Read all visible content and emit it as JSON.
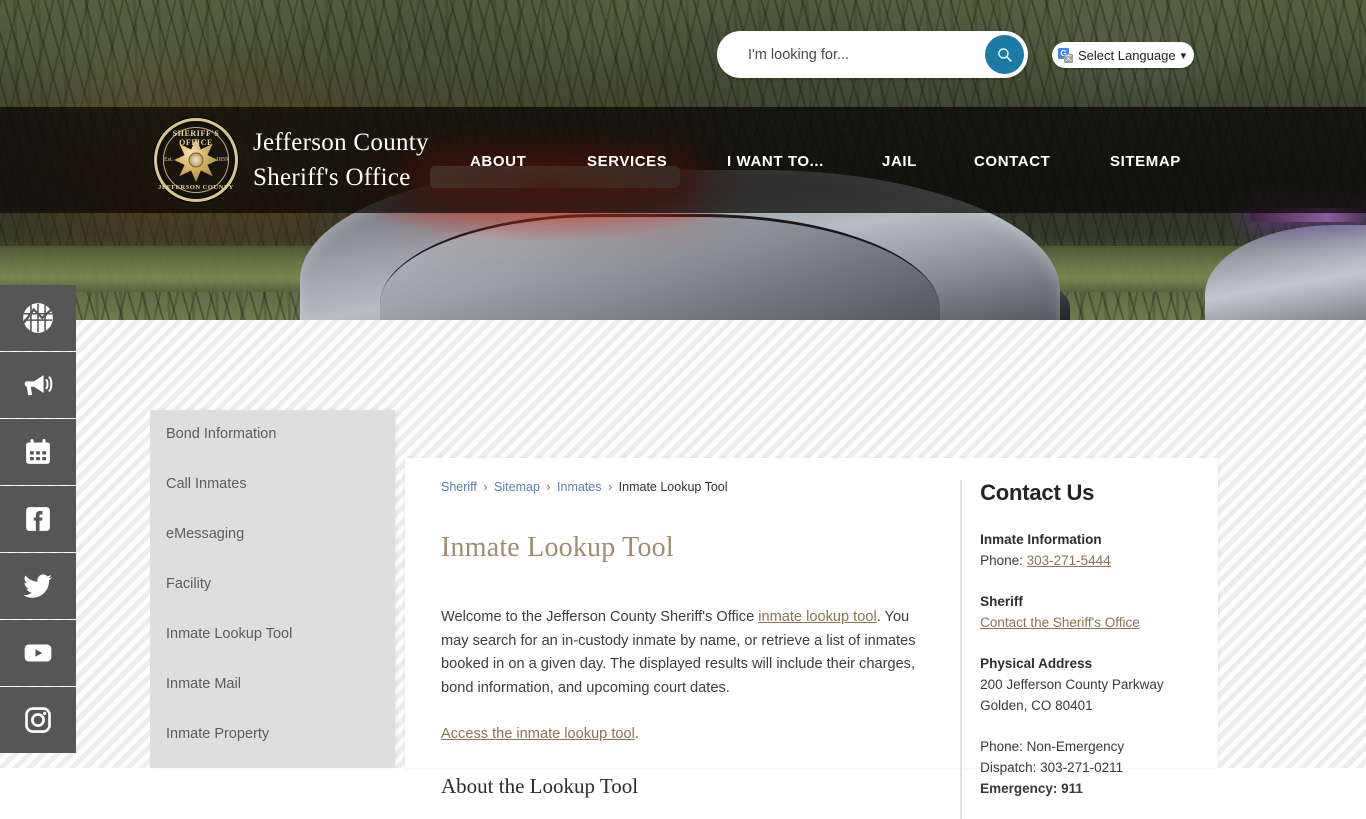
{
  "header": {
    "brand_line1": "Jefferson County",
    "brand_line2": "Sheriff's Office",
    "badge_top": "SHERIFF'S OFFICE",
    "badge_bottom": "JEFFERSON COUNTY",
    "badge_est_left": "Est.",
    "badge_est_right": "1859",
    "search": {
      "placeholder": "I'm looking for...",
      "value": "",
      "button_icon": "search-icon",
      "button_color": "#1c7aa6"
    },
    "language": {
      "label": "Select Language",
      "icon": "google-translate-icon",
      "chevron": "∨"
    },
    "nav": [
      {
        "label": "ABOUT"
      },
      {
        "label": "SERVICES"
      },
      {
        "label": "I WANT TO..."
      },
      {
        "label": "JAIL"
      },
      {
        "label": "CONTACT"
      },
      {
        "label": "SITEMAP"
      }
    ]
  },
  "social_rail": [
    {
      "name": "map-icon"
    },
    {
      "name": "megaphone-icon"
    },
    {
      "name": "calendar-icon"
    },
    {
      "name": "facebook-icon"
    },
    {
      "name": "twitter-icon"
    },
    {
      "name": "youtube-icon"
    },
    {
      "name": "instagram-icon"
    }
  ],
  "sidebar": {
    "items": [
      {
        "label": "Bond Information",
        "active": false
      },
      {
        "label": "Call Inmates",
        "active": false
      },
      {
        "label": "eMessaging",
        "active": false
      },
      {
        "label": "Facility",
        "active": false
      },
      {
        "label": "Inmate Lookup Tool",
        "active": true
      },
      {
        "label": "Inmate Mail",
        "active": false
      },
      {
        "label": "Inmate Property",
        "active": false
      }
    ]
  },
  "breadcrumb": {
    "items": [
      {
        "label": "Sheriff",
        "link": true
      },
      {
        "label": "Sitemap",
        "link": true
      },
      {
        "label": "Inmates",
        "link": true
      },
      {
        "label": "Inmate Lookup Tool",
        "link": false
      }
    ],
    "separator": "›"
  },
  "main": {
    "title": "Inmate Lookup Tool",
    "paragraph": {
      "part1": "Welcome to the Jefferson County Sheriff's Office ",
      "link1": "inmate lookup tool",
      "part2": ". You may search for an in-custody inmate by name, or retrieve a list of inmates booked in on a given day. The displayed results will include their charges, bond information, and upcoming court dates."
    },
    "access_link": "Access the inmate lookup tool",
    "access_suffix": ".",
    "subheading": "About the Lookup Tool"
  },
  "contact": {
    "heading": "Contact Us",
    "blocks": [
      {
        "label": "Inmate Information",
        "line_prefix": "Phone: ",
        "link": "303-271-5444"
      },
      {
        "label": "Sheriff",
        "link": "Contact the Sheriff's Office"
      },
      {
        "label": "Physical Address",
        "line1": "200 Jefferson County Parkway",
        "line2": "Golden, CO 80401"
      },
      {
        "line1": "Phone: Non-Emergency",
        "line2": "Dispatch: 303-271-0211",
        "strong": "Emergency: 911"
      }
    ]
  },
  "colors": {
    "accent_gold": "#a08c6e",
    "link_brown": "#8a7351",
    "search_blue": "#1c7aa6",
    "rail_gray": "#565656",
    "sidebar_gray": "#dedede"
  }
}
